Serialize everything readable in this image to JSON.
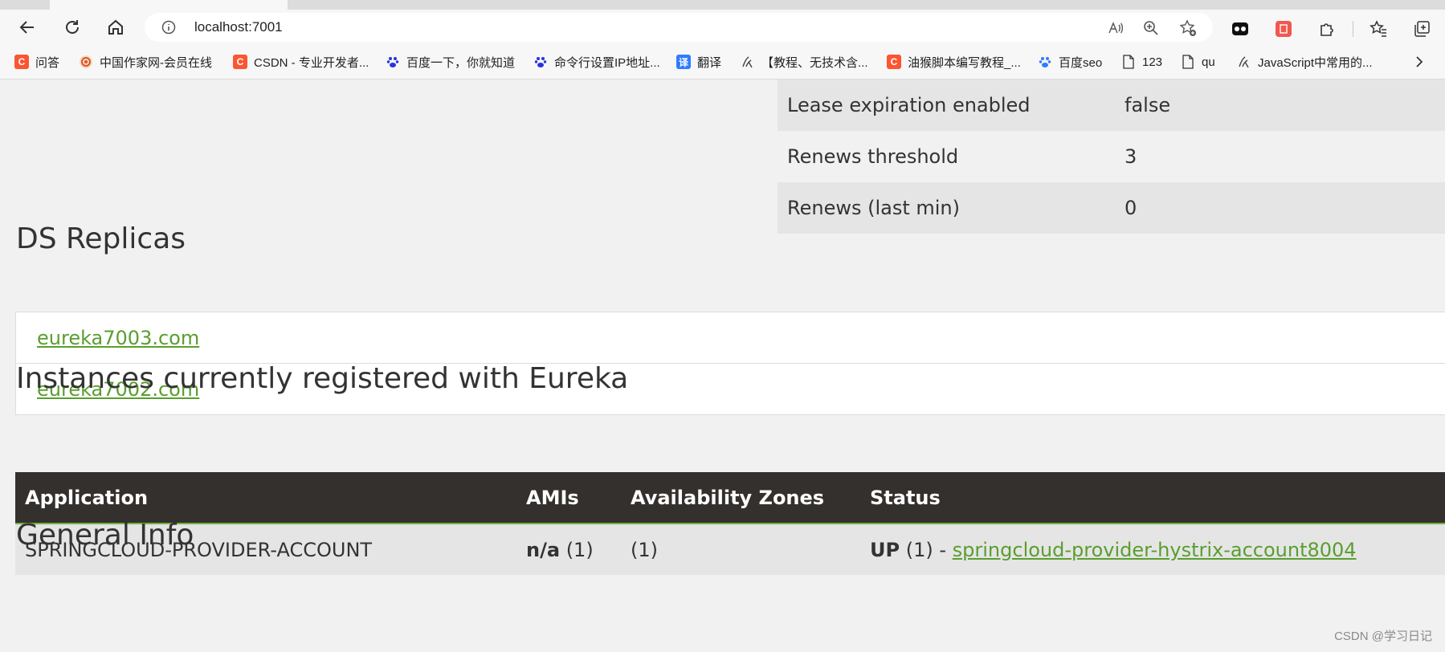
{
  "browser": {
    "url": "localhost:7001",
    "bookmarks": [
      {
        "label": "问答",
        "icon": "csdn-icon",
        "glyph": "C"
      },
      {
        "label": "中国作家网-会员在线",
        "icon": "writer-site-icon",
        "glyph": ""
      },
      {
        "label": "CSDN - 专业开发者...",
        "icon": "csdn-icon",
        "glyph": "C"
      },
      {
        "label": "百度一下，你就知道",
        "icon": "baidu-paw-icon",
        "glyph": ""
      },
      {
        "label": "命令行设置IP地址...",
        "icon": "baidu-paw-icon",
        "glyph": ""
      },
      {
        "label": "翻译",
        "icon": "translate-icon",
        "glyph": "译"
      },
      {
        "label": "【教程、无技术含...",
        "icon": "handwave-icon",
        "glyph": ""
      },
      {
        "label": "油猴脚本编写教程_...",
        "icon": "csdn-icon",
        "glyph": "C"
      },
      {
        "label": "百度seo",
        "icon": "baidu-paw-icon",
        "glyph": ""
      },
      {
        "label": "123",
        "icon": "page-icon",
        "glyph": ""
      },
      {
        "label": "qu",
        "icon": "page-icon",
        "glyph": ""
      },
      {
        "label": "JavaScript中常用的...",
        "icon": "handwave-icon",
        "glyph": ""
      }
    ]
  },
  "stats": {
    "rows": [
      {
        "key": "Lease expiration enabled",
        "value": "false"
      },
      {
        "key": "Renews threshold",
        "value": "3"
      },
      {
        "key": "Renews (last min)",
        "value": "0"
      }
    ]
  },
  "replicas": {
    "title": "DS Replicas",
    "items": [
      "eureka7003.com",
      "eureka7002.com"
    ]
  },
  "instances": {
    "title": "Instances currently registered with Eureka",
    "headers": [
      "Application",
      "AMIs",
      "Availability Zones",
      "Status"
    ],
    "row": {
      "application": "SPRINGCLOUD-PROVIDER-ACCOUNT",
      "ami_name": "n/a",
      "ami_count": "(1)",
      "zones": "(1)",
      "status_state": "UP",
      "status_count": "(1) -",
      "status_link": "springcloud-provider-hystrix-account8004"
    }
  },
  "general": {
    "title": "General Info"
  },
  "watermark": "CSDN @学习日记",
  "colors": {
    "link": "#5a9e2f",
    "header_bg": "#34302d",
    "header_border": "#6db33f"
  }
}
